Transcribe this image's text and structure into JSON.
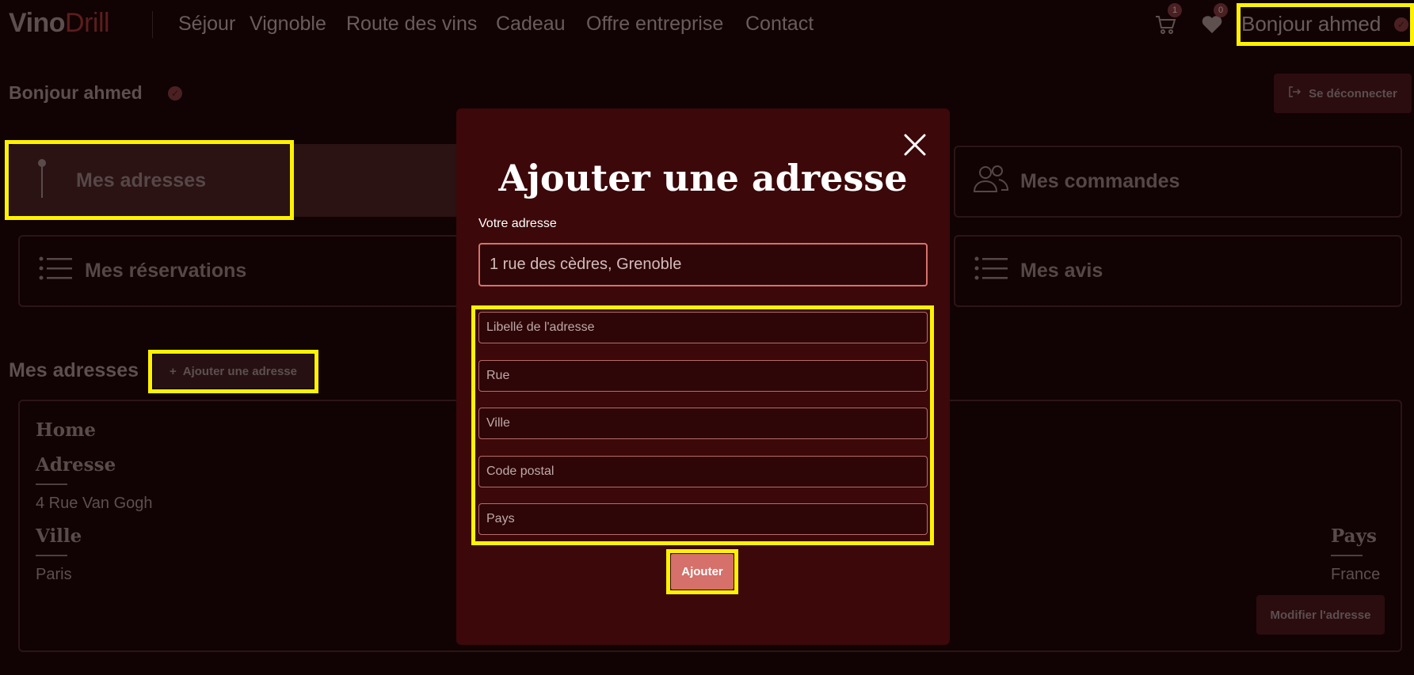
{
  "navbar": {
    "logo_part1": "Vino",
    "logo_part2": "Drill",
    "links": [
      "Séjour",
      "Vignoble",
      "Route des vins",
      "Cadeau",
      "Offre entreprise",
      "Contact"
    ],
    "cart_count": "1",
    "favorites_count": "0",
    "user_greeting": "Bonjour ahmed"
  },
  "header": {
    "greeting": "Bonjour ahmed",
    "logout_label": "Se déconnecter"
  },
  "cards": {
    "addresses": "Mes adresses",
    "orders": "Mes commandes",
    "reservations": "Mes réservations",
    "reviews": "Mes avis"
  },
  "addresses_section": {
    "title": "Mes adresses",
    "add_button": "Ajouter une adresse",
    "entry": {
      "name": "Home",
      "address_label": "Adresse",
      "address_value": "4 Rue Van Gogh",
      "city_label": "Ville",
      "city_value": "Paris",
      "country_label": "Pays",
      "country_value": "France",
      "edit_button": "Modifier l'adresse"
    }
  },
  "modal": {
    "title": "Ajouter une adresse",
    "address_label": "Votre adresse",
    "address_value": "1 rue des cèdres, Grenoble",
    "fields": {
      "label": "Libellé de l'adresse",
      "street": "Rue",
      "city": "Ville",
      "postal_code": "Code postal",
      "country": "Pays"
    },
    "submit_label": "Ajouter"
  },
  "icons": {
    "cart": "cart-icon",
    "favorites": "heart-icon",
    "close": "close-icon",
    "pin": "pin-icon",
    "users": "users-icon",
    "list": "list-icon",
    "logout": "logout-icon",
    "plus": "plus-icon"
  },
  "colors": {
    "background": "#110203",
    "modal": "#3c0809",
    "accent": "#d5706a",
    "highlight": "#fff200"
  }
}
